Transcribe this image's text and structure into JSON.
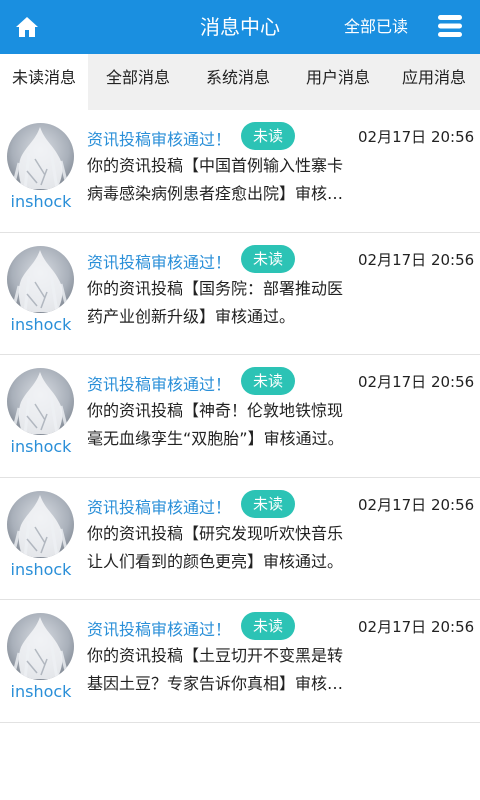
{
  "header": {
    "title": "消息中心",
    "read_all_label": "全部已读",
    "home_icon": "home-icon",
    "menu_icon": "menu-icon",
    "color": "#1a8fe0"
  },
  "tabs": [
    {
      "label": "未读消息",
      "active": true
    },
    {
      "label": "全部消息",
      "active": false
    },
    {
      "label": "系统消息",
      "active": false
    },
    {
      "label": "用户消息",
      "active": false
    },
    {
      "label": "应用消息",
      "active": false
    }
  ],
  "messages": [
    {
      "username": "inshock",
      "title": "资讯投稿审核通过！",
      "badge": "未读",
      "time": "02月17日 20:56",
      "content": "你的资讯投稿【中国首例输入性寨卡病毒感染病例患者痊愈出院】审核通过。"
    },
    {
      "username": "inshock",
      "title": "资讯投稿审核通过！",
      "badge": "未读",
      "time": "02月17日 20:56",
      "content": "你的资讯投稿【国务院：部署推动医药产业创新升级】审核通过。"
    },
    {
      "username": "inshock",
      "title": "资讯投稿审核通过！",
      "badge": "未读",
      "time": "02月17日 20:56",
      "content": "你的资讯投稿【神奇！伦敦地铁惊现毫无血缘孪生“双胞胎”】审核通过。"
    },
    {
      "username": "inshock",
      "title": "资讯投稿审核通过！",
      "badge": "未读",
      "time": "02月17日 20:56",
      "content": "你的资讯投稿【研究发现听欢快音乐让人们看到的颜色更亮】审核通过。"
    },
    {
      "username": "inshock",
      "title": "资讯投稿审核通过！",
      "badge": "未读",
      "time": "02月17日 20:56",
      "content": "你的资讯投稿【土豆切开不变黑是转基因土豆？专家告诉你真相】审核通过。"
    }
  ]
}
